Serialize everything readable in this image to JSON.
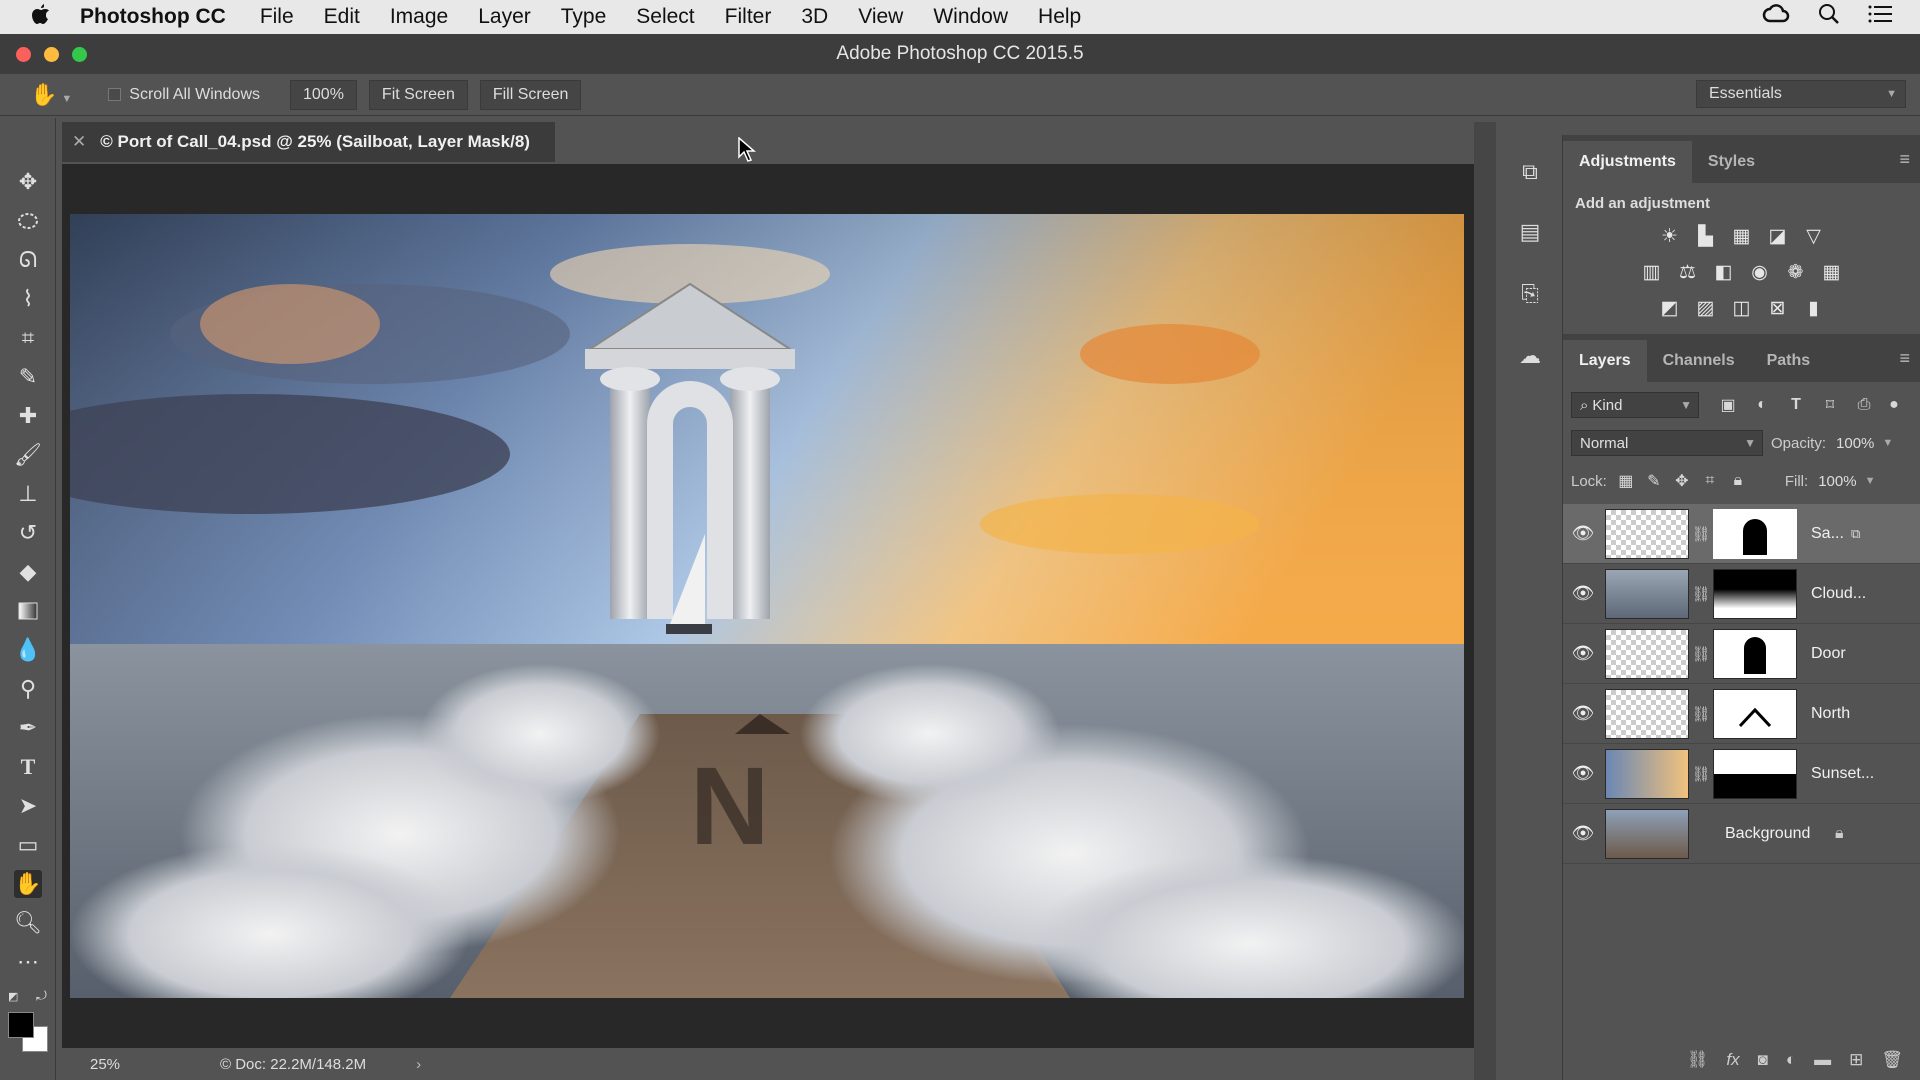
{
  "menubar": {
    "app_name": "Photoshop CC",
    "items": [
      "File",
      "Edit",
      "Image",
      "Layer",
      "Type",
      "Select",
      "Filter",
      "3D",
      "View",
      "Window",
      "Help"
    ]
  },
  "window": {
    "title": "Adobe Photoshop CC 2015.5"
  },
  "options": {
    "scroll_all_windows": "Scroll All Windows",
    "zoom_btn": "100%",
    "fit_screen": "Fit Screen",
    "fill_screen": "Fill Screen",
    "workspace": "Essentials"
  },
  "document": {
    "tab_title": "© Port of Call_04.psd @ 25% (Sailboat, Layer Mask/8)",
    "zoom": "25%",
    "doc_info": "© Doc: 22.2M/148.2M"
  },
  "adjustments": {
    "tabs": [
      "Adjustments",
      "Styles"
    ],
    "heading": "Add an adjustment"
  },
  "layers_panel": {
    "tabs": [
      "Layers",
      "Channels",
      "Paths"
    ],
    "kind_filter": "Kind",
    "blend_mode": "Normal",
    "opacity_label": "Opacity:",
    "opacity_value": "100%",
    "lock_label": "Lock:",
    "fill_label": "Fill:",
    "fill_value": "100%",
    "layers": [
      {
        "name": "Sa...",
        "selected": true
      },
      {
        "name": "Cloud..."
      },
      {
        "name": "Door"
      },
      {
        "name": "North"
      },
      {
        "name": "Sunset..."
      },
      {
        "name": "Background"
      }
    ]
  },
  "colors": {
    "panel_bg": "#535353",
    "dark_bg": "#282828",
    "selected_layer": "#6a6a6a",
    "close_red": "#fc605c",
    "minimize_yellow": "#fdbc40",
    "maximize_green": "#34c84a"
  }
}
